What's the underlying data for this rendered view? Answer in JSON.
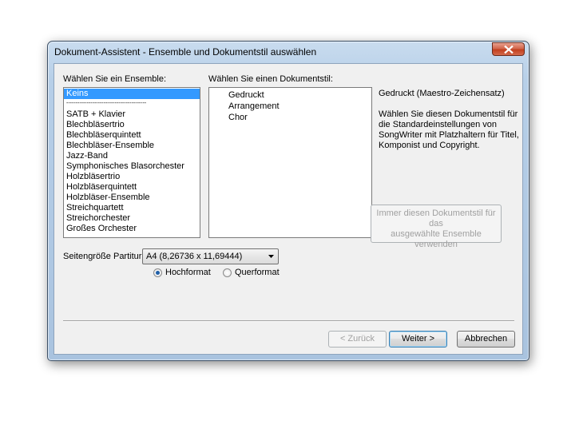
{
  "window": {
    "title": "Dokument-Assistent - Ensemble und Dokumentstil auswählen",
    "close_icon": "close-icon",
    "close_color": "#c2401f"
  },
  "ensemble": {
    "label": "Wählen Sie ein Ensemble:",
    "selected": "Keins",
    "separator": "-------------------------------------------",
    "items": [
      "SATB + Klavier",
      "Blechbläsertrio",
      "Blechbläserquintett",
      "Blechbläser-Ensemble",
      "Jazz-Band",
      "Symphonisches Blasorchester",
      "Holzbläsertrio",
      "Holzbläserquintett",
      "Holzbläser-Ensemble",
      "Streichquartett",
      "Streichorchester",
      "Großes Orchester"
    ]
  },
  "style": {
    "label": "Wählen Sie einen Dokumentstil:",
    "items": [
      "Gedruckt",
      "Arrangement",
      "Chor"
    ]
  },
  "description": {
    "title": "Gedruckt (Maestro-Zeichensatz)",
    "lines": [
      "Wählen Sie diesen Dokumentstil für",
      "die Standardeinstellungen von",
      "SongWriter mit Platzhaltern für Titel,",
      "Komponist und Copyright."
    ]
  },
  "always_button": {
    "lines": [
      "Immer diesen Dokumentstil für das",
      "ausgewählte Ensemble",
      "verwenden"
    ]
  },
  "page_size": {
    "label": "Seitengröße Partitur:",
    "value": "A4 (8,26736 x 11,69444)",
    "portrait": "Hochformat",
    "landscape": "Querformat",
    "selected": "Hochformat"
  },
  "buttons": {
    "back": "< Zurück",
    "next": "Weiter >",
    "cancel": "Abbrechen"
  },
  "colors": {
    "selection": "#3399ff",
    "accent": "#1f5fa8"
  }
}
